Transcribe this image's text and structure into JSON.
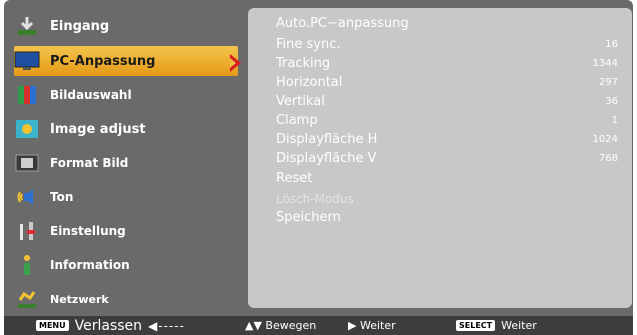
{
  "left_menu": {
    "items": [
      {
        "label": "Eingang",
        "icon": "input-icon"
      },
      {
        "label": "PC-Anpassung",
        "icon": "pc-adjust-icon",
        "selected": true
      },
      {
        "label": "Bildauswahl",
        "icon": "image-select-icon"
      },
      {
        "label": "Image adjust",
        "icon": "image-adjust-icon"
      },
      {
        "label": "Format Bild",
        "icon": "screen-format-icon"
      },
      {
        "label": "Ton",
        "icon": "sound-icon"
      },
      {
        "label": "Einstellung",
        "icon": "settings-icon"
      },
      {
        "label": "Information",
        "icon": "information-icon"
      },
      {
        "label": "Netzwerk",
        "icon": "network-icon"
      }
    ]
  },
  "submenu": {
    "title": "Auto.PC−anpassung",
    "rows": [
      {
        "label": "Fine sync.",
        "value": "16"
      },
      {
        "label": "Tracking",
        "value": "1344"
      },
      {
        "label": "Horizontal",
        "value": "297"
      },
      {
        "label": "Vertikal",
        "value": "36"
      },
      {
        "label": "Clamp",
        "value": "1"
      },
      {
        "label": "Displayfläche H",
        "value": "1024"
      },
      {
        "label": "Displayfläche V",
        "value": "768"
      },
      {
        "label": "Reset",
        "value": ""
      },
      {
        "label": "Lösch-Modus",
        "value": ""
      },
      {
        "label": "Speichern",
        "value": ""
      }
    ]
  },
  "bottom_bar": {
    "menu_key": "MENU",
    "exit_label": "Verlassen",
    "exit_arrow": "◀-----",
    "move_label": "▲▼ Bewegen",
    "next_label": "▶ Weiter",
    "select_key": "SELECT",
    "select_label": "Weiter"
  }
}
